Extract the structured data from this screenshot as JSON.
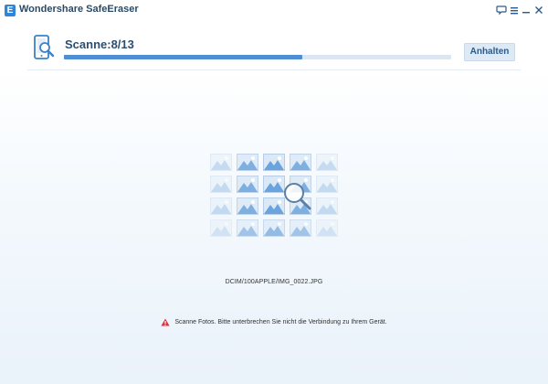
{
  "window": {
    "title": "Wondershare SafeEraser",
    "logo_letter": "E",
    "controls": [
      "feedback-icon",
      "menu-icon",
      "minimize-icon",
      "close-icon"
    ]
  },
  "scan": {
    "status_text": "Scanne:8/13",
    "progress_fraction": 0.6154,
    "pause_label": "Anhalten",
    "current_file": "DCIM/100APPLE/IMG_0022.JPG",
    "warning_text": "Scanne Fotos. Bitte unterbrechen Sie nicht die Verbindung zu Ihrem Gerät."
  },
  "colors": {
    "accent": "#4f8ed3",
    "progress_track": "#dbe6f1",
    "warning": "#d9343f",
    "title_text": "#2b4f73"
  }
}
